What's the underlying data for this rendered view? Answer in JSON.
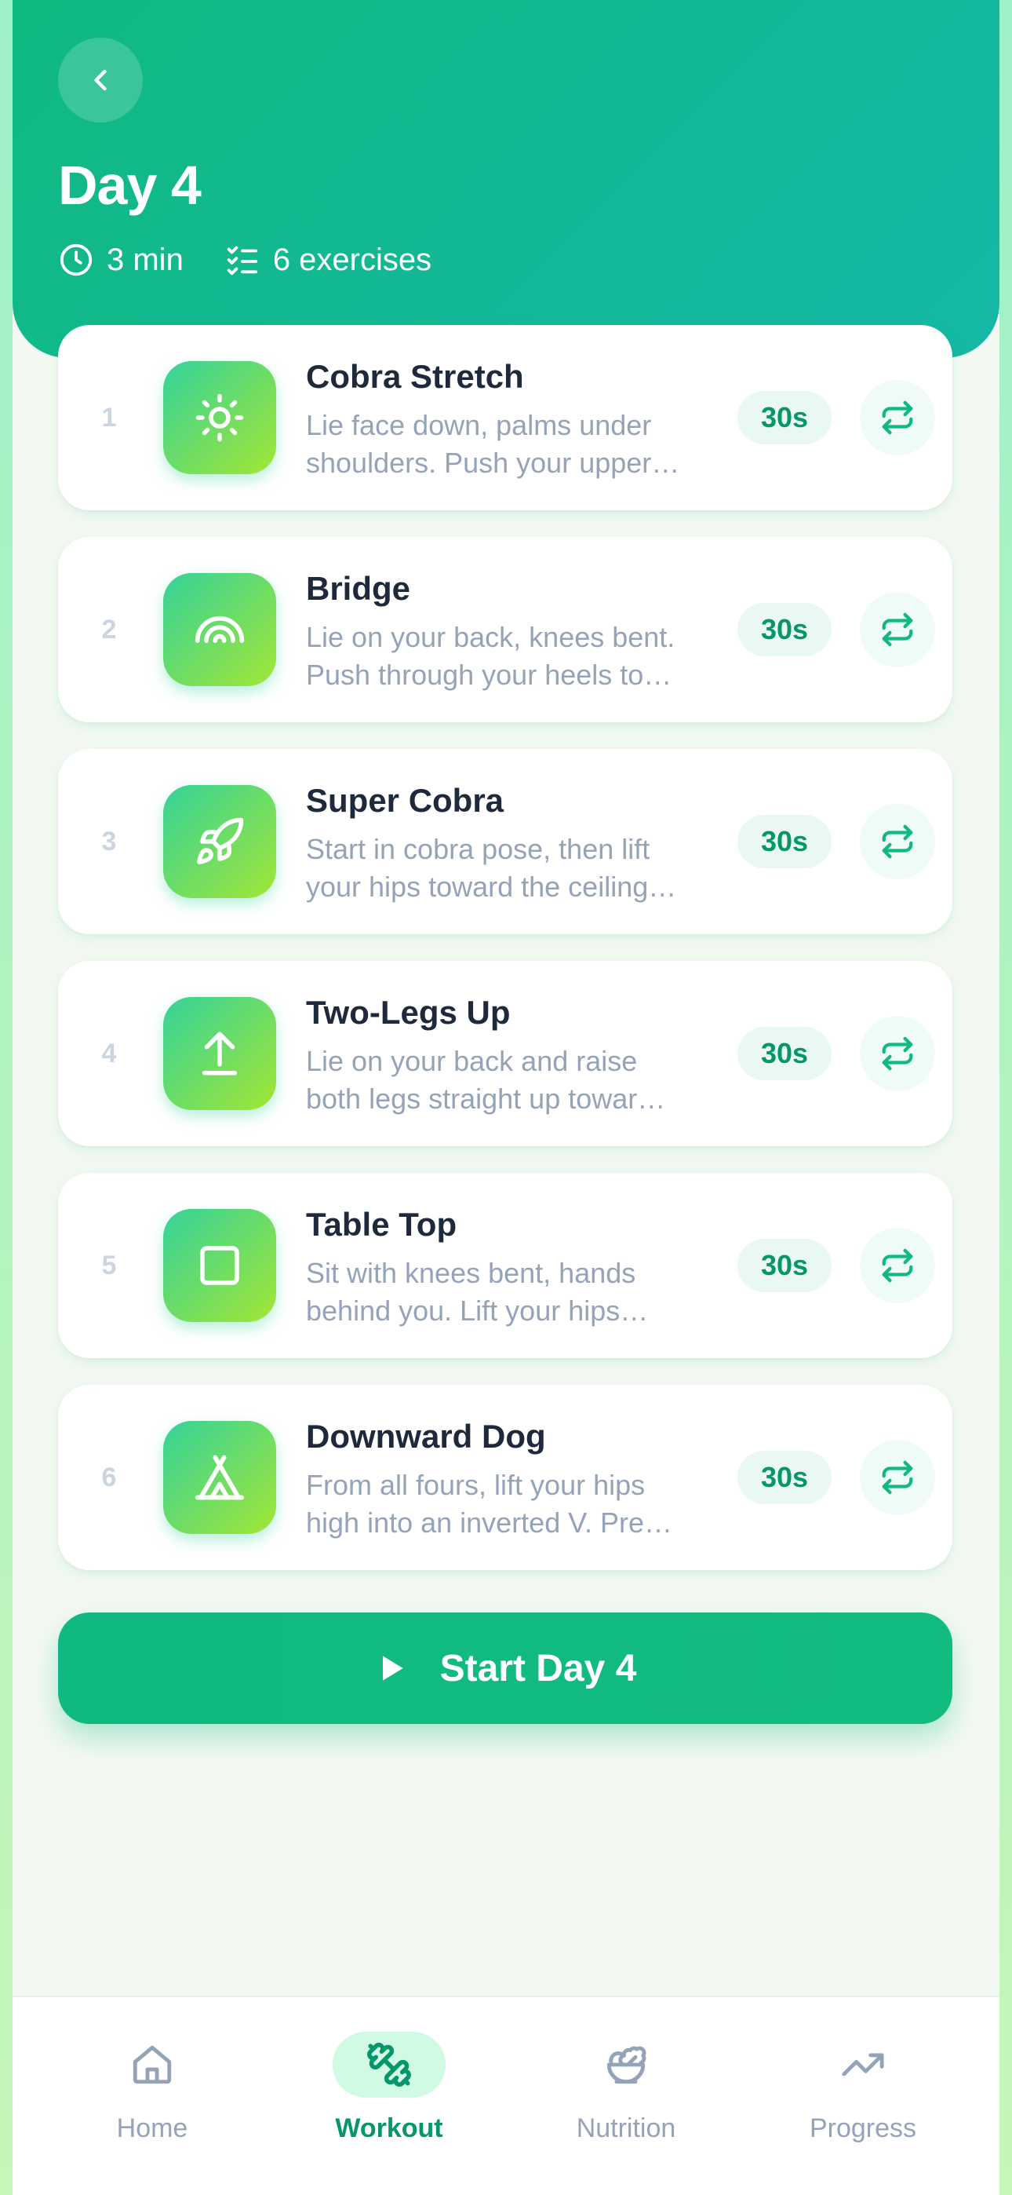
{
  "header": {
    "title": "Day 4",
    "duration": "3 min",
    "exercise_count": "6 exercises"
  },
  "exercises": [
    {
      "number": "1",
      "title": "Cobra Stretch",
      "description": "Lie face down, palms under shoulders. Push your upper…",
      "duration": "30s",
      "icon": "sun-icon"
    },
    {
      "number": "2",
      "title": "Bridge",
      "description": "Lie on your back, knees bent. Push through your heels to…",
      "duration": "30s",
      "icon": "rainbow-icon"
    },
    {
      "number": "3",
      "title": "Super Cobra",
      "description": "Start in cobra pose, then lift your hips toward the ceiling…",
      "duration": "30s",
      "icon": "rocket-icon"
    },
    {
      "number": "4",
      "title": "Two-Legs Up",
      "description": "Lie on your back and raise both legs straight up towar…",
      "duration": "30s",
      "icon": "arrow-up-to-line-icon"
    },
    {
      "number": "5",
      "title": "Table Top",
      "description": "Sit with knees bent, hands behind you. Lift your hips…",
      "duration": "30s",
      "icon": "square-icon"
    },
    {
      "number": "6",
      "title": "Downward Dog",
      "description": "From all fours, lift your hips high into an inverted V. Pre…",
      "duration": "30s",
      "icon": "tent-icon"
    }
  ],
  "start_button": {
    "label": "Start Day 4"
  },
  "nav": {
    "items": [
      {
        "label": "Home",
        "icon": "home-icon",
        "active": false
      },
      {
        "label": "Workout",
        "icon": "dumbbell-icon",
        "active": true
      },
      {
        "label": "Nutrition",
        "icon": "salad-icon",
        "active": false
      },
      {
        "label": "Progress",
        "icon": "trending-up-icon",
        "active": false
      }
    ]
  },
  "colors": {
    "primary": "#10b981",
    "primary_dark": "#059669",
    "header_gradient_end": "#14b8a6",
    "icon_gradient_start": "#34d399",
    "icon_gradient_end": "#a3e635",
    "background": "#f3f9f2"
  }
}
